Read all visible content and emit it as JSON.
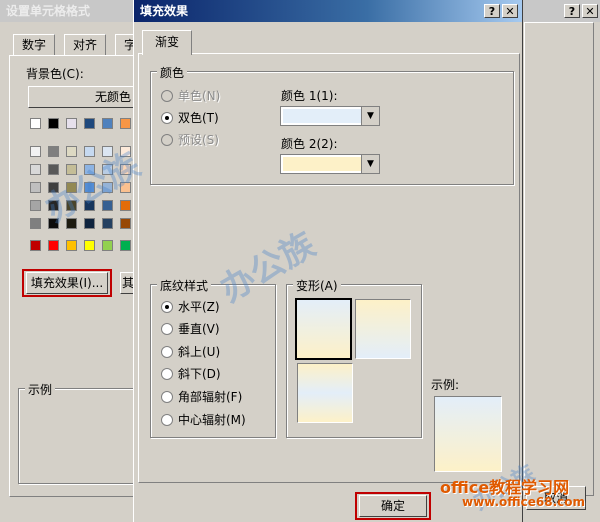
{
  "bg_dialog": {
    "title": "设置单元格格式",
    "tabs": [
      "数字",
      "对齐",
      "字"
    ],
    "bg_color_label": "背景色(C):",
    "no_color_button": "无颜色",
    "fill_effects_button": "填充效果(I)...",
    "pattern_button_fragment": "其",
    "sample_label": "示例",
    "cancel_button": "取消"
  },
  "fill_dialog": {
    "title": "填充效果",
    "help_icon": "?",
    "close_icon": "✕",
    "tab": "渐变",
    "colors_group": "颜色",
    "radio_one_color": "单色(N)",
    "radio_two_colors": "双色(T)",
    "radio_preset": "预设(S)",
    "color1_label": "颜色 1(1):",
    "color2_label": "颜色 2(2):",
    "color1_value": "#e3eef9",
    "color2_value": "#fdf1c8",
    "shading_group": "底纹样式",
    "styles": [
      "水平(Z)",
      "垂直(V)",
      "斜上(U)",
      "斜下(D)",
      "角部辐射(F)",
      "中心辐射(M)"
    ],
    "variants_group": "变形(A)",
    "sample_label": "示例:",
    "ok_button": "确定"
  },
  "watermark": {
    "brand": "office教程学习网",
    "url": "www.office68.com"
  },
  "colors": {
    "accent_red": "#c00000",
    "title_active": "#0a246a"
  }
}
